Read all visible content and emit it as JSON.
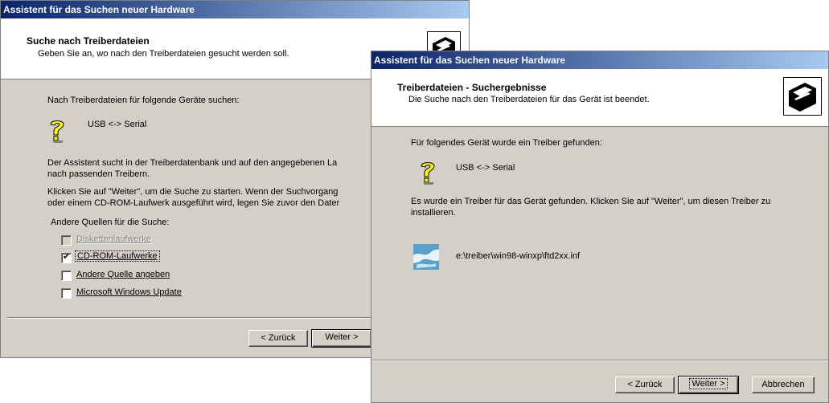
{
  "win1": {
    "title": "Assistent für das Suchen neuer Hardware",
    "header_title": "Suche nach Treiberdateien",
    "header_sub": "Geben Sie an, wo nach den Treiberdateien gesucht werden soll.",
    "prompt": "Nach Treiberdateien für folgende Geräte suchen:",
    "device": "USB <-> Serial",
    "desc1a": "Der Assistent sucht in der Treiberdatenbank und auf den angegebenen La",
    "desc1b": "nach passenden Treibern.",
    "desc2a": "Klicken Sie auf \"Weiter\", um die Suche zu starten. Wenn der Suchvorgang",
    "desc2b": "oder einem CD-ROM-Laufwerk ausgeführt wird, legen Sie zuvor den Dater",
    "sources_label": "Andere Quellen für die Suche:",
    "options": [
      {
        "label": "Diskettenlaufwerke",
        "checked": false,
        "disabled": true
      },
      {
        "label": "CD-ROM-Laufwerke",
        "checked": true,
        "disabled": false
      },
      {
        "label": "Andere Quelle angeben",
        "checked": false,
        "disabled": false
      },
      {
        "label": "Microsoft Windows Update",
        "checked": false,
        "disabled": false
      }
    ],
    "back_label": "< Zurück",
    "next_label": "Weiter >"
  },
  "win2": {
    "title": "Assistent für das Suchen neuer Hardware",
    "header_title": "Treiberdateien - Suchergebnisse",
    "header_sub": "Die Suche nach den Treiberdateien für das Gerät ist beendet.",
    "prompt": "Für folgendes Gerät wurde ein Treiber gefunden:",
    "device": "USB <-> Serial",
    "desc1a": "Es wurde ein Treiber für das Gerät gefunden. Klicken Sie auf \"Weiter\", um diesen Treiber zu",
    "desc1b": "installieren.",
    "file_path": "e:\\treiber\\win98-winxp\\ftd2xx.inf",
    "back_label": "< Zurück",
    "next_label": "Weiter >",
    "cancel_label": "Abbrechen"
  }
}
